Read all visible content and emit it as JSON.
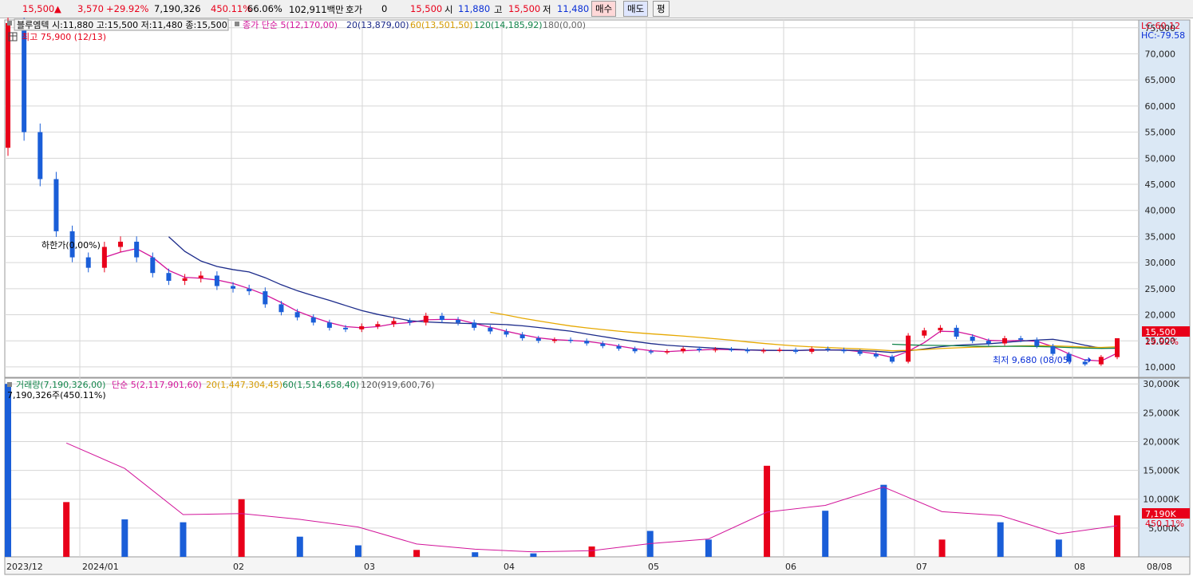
{
  "quote": {
    "price": "15,500",
    "change": "3,570",
    "change_pct": "+29.92%",
    "volume": "7,190,326",
    "volume_ratio": "450.11%",
    "turnover_pct": "66.06%",
    "amount": "102,911백만",
    "hoga_label": "호가",
    "hoga_value": "0",
    "hoga_price": "15,500",
    "open_label": "시",
    "open": "11,880",
    "high_label": "고",
    "high": "15,500",
    "low_label": "저",
    "low": "11,480",
    "buy_label": "매수",
    "sell_label": "매도",
    "eval_label": "평"
  },
  "colors": {
    "up": "#e8001a",
    "down": "#1a5ed8",
    "ma5": "#d2149a",
    "ma20": "#1b2a8a",
    "ma60": "#e6a800",
    "ma120": "#12844a",
    "grid": "#d6d6d6",
    "axis_bg": "#dbe8f5"
  },
  "price_panel": {
    "legend_name": "블루엠텍 시:11,880 고:15,500 저:11,480 종:15,500",
    "legend_ma_title": "종가 단순 5(12,170,00)",
    "legend_ma20": "20(13,879,00)",
    "legend_ma60": "60(13,501,50)",
    "legend_ma120": "120(14,185,92)",
    "legend_ma180": "180(0,00)",
    "high_note": "최고 75,900 (12/13)",
    "low_note": "최저 9,680 (08/05)",
    "limit_note": "하한가(0,00%)",
    "lc_label": "LC:60.12",
    "hc_label": "HC:-79.58",
    "current_price_tag": "15,500",
    "current_pct_tag": "29.92%",
    "y_ticks": [
      "75,000",
      "70,000",
      "65,000",
      "60,000",
      "55,000",
      "50,000",
      "45,000",
      "40,000",
      "35,000",
      "30,000",
      "25,000",
      "20,000",
      "15,000",
      "10,000"
    ]
  },
  "volume_panel": {
    "legend_title": "거래량(7,190,326,00)",
    "legend_ma5": "단순 5(2,117,901,60)",
    "legend_ma20": "20(1,447,304,45)",
    "legend_ma60": "60(1,514,658,40)",
    "legend_ma120": "120(919,600,76)",
    "note": "7,190,326주(450.11%)",
    "current_tag": "7,190K",
    "current_pct_tag": "450.11%",
    "y_ticks": [
      "30,000K",
      "25,000K",
      "20,000K",
      "15,000K",
      "10,000K",
      "5,000K"
    ]
  },
  "x_ticks": [
    "2023/12",
    "2024/01",
    "02",
    "03",
    "04",
    "05",
    "06",
    "07",
    "08",
    "08/08"
  ],
  "chart_data": {
    "type": "candlestick",
    "title": "블루엠텍",
    "price_ylim": [
      8000,
      76500
    ],
    "volume_ylim_k": [
      0,
      31000
    ],
    "x_months": [
      "2023/12",
      "2024/01",
      "02",
      "03",
      "04",
      "05",
      "06",
      "07",
      "08"
    ],
    "approx_daily_closes": [
      75900,
      55000,
      46000,
      36000,
      31000,
      29000,
      33000,
      34000,
      31000,
      28000,
      26500,
      27000,
      27500,
      25500,
      25000,
      24500,
      22000,
      20500,
      19500,
      18500,
      17500,
      17200,
      17800,
      18200,
      18800,
      18500,
      19800,
      19000,
      18500,
      17500,
      16800,
      16200,
      15500,
      15000,
      15200,
      15000,
      14500,
      14000,
      13500,
      13000,
      12800,
      13000,
      13500,
      13200,
      13400,
      13300,
      13000,
      13200,
      13300,
      12900,
      13500,
      13300,
      13000,
      12500,
      12000,
      11000,
      16000,
      17000,
      17500,
      15800,
      15000,
      14500,
      15500,
      15200,
      14000,
      12500,
      11000,
      10500,
      11920,
      15500
    ],
    "last_candle": {
      "open": 11880,
      "high": 15500,
      "low": 11480,
      "close": 15500,
      "volume": 7190326
    },
    "ma5_last": 12170,
    "ma20_last": 13879,
    "ma60_last": 13501.5,
    "ma120_last": 14185.92,
    "period_high": {
      "value": 75900,
      "date": "12/13"
    },
    "period_low": {
      "value": 9680,
      "date": "08/05"
    },
    "approx_volume_k": [
      30000,
      9500,
      6500,
      6000,
      10000,
      3500,
      2000,
      1200,
      800,
      600,
      1800,
      4500,
      3000,
      15800,
      8000,
      12500,
      3000,
      6000,
      3000,
      7190
    ]
  }
}
